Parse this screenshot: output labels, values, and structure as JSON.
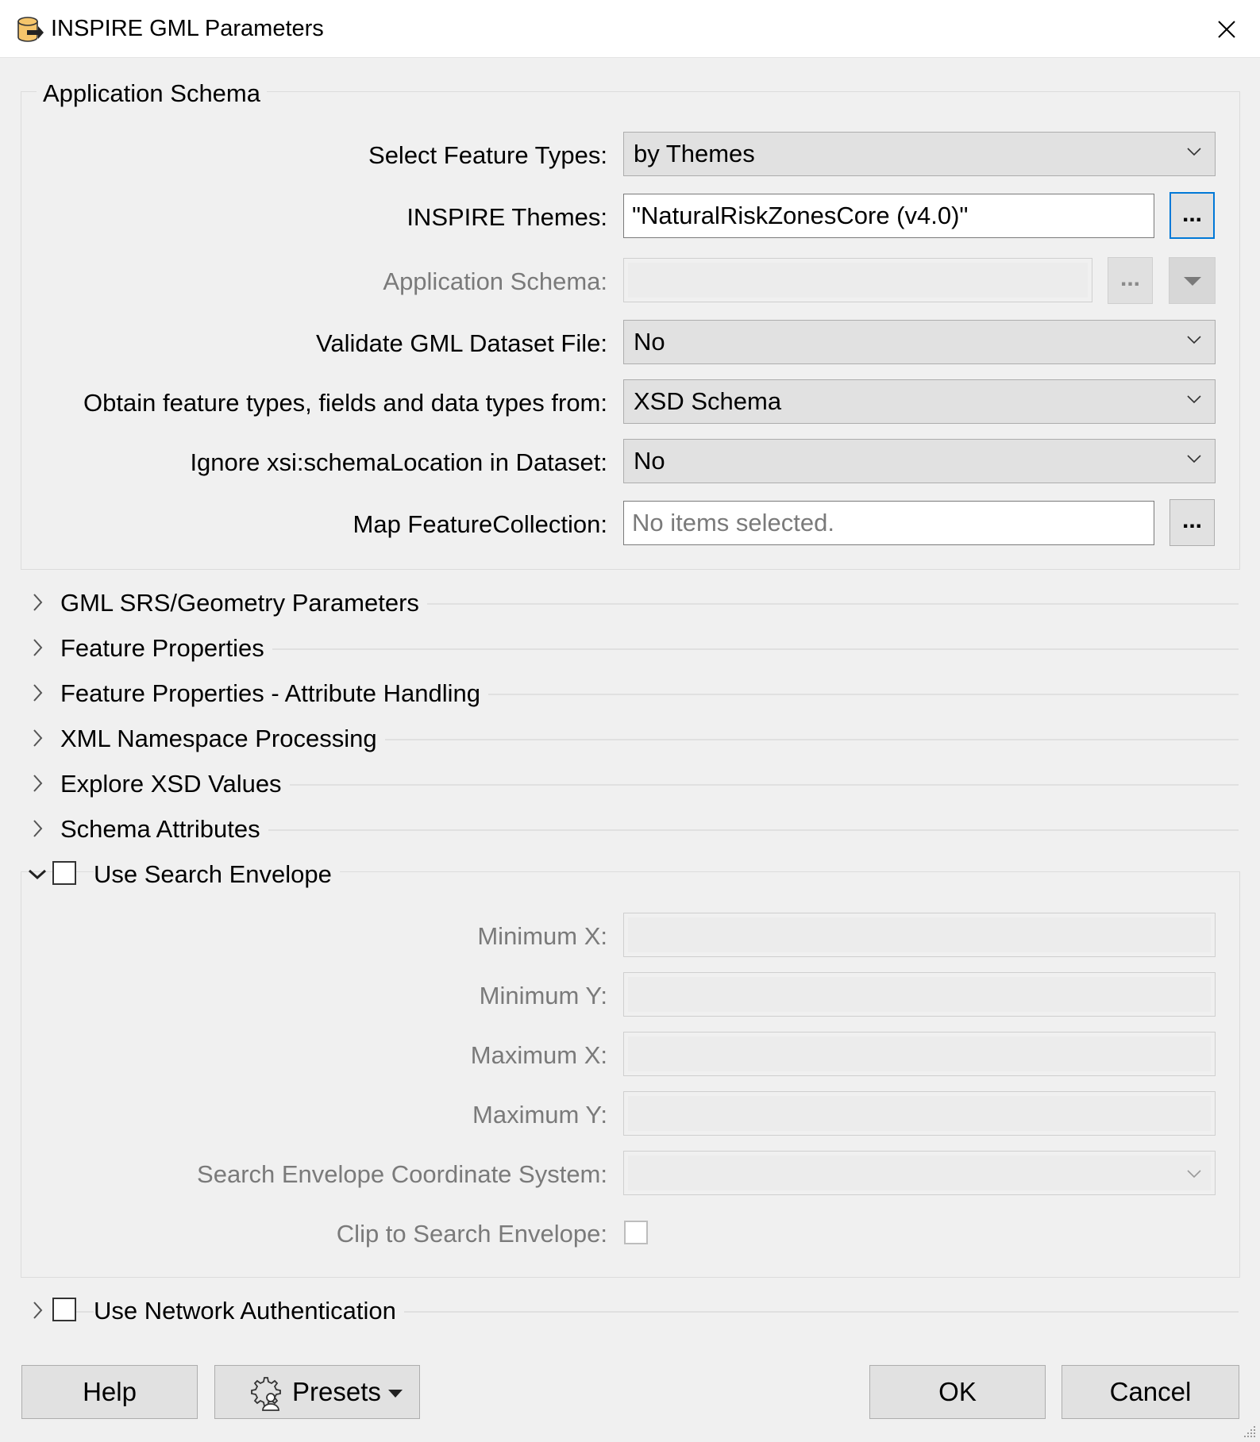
{
  "window": {
    "title": "INSPIRE GML Parameters"
  },
  "application_schema": {
    "group_title": "Application Schema",
    "select_feature_types": {
      "label": "Select Feature Types:",
      "value": "by Themes"
    },
    "inspire_themes": {
      "label": "INSPIRE Themes:",
      "value": "\"NaturalRiskZonesCore (v4.0)\"",
      "button": "..."
    },
    "application_schema": {
      "label": "Application Schema:",
      "value": "",
      "button": "..."
    },
    "validate_gml": {
      "label": "Validate GML Dataset File:",
      "value": "No"
    },
    "obtain_from": {
      "label": "Obtain feature types, fields and data types from:",
      "value": "XSD Schema"
    },
    "ignore_xsi": {
      "label": "Ignore xsi:schemaLocation in Dataset:",
      "value": "No"
    },
    "map_feature_collection": {
      "label": "Map FeatureCollection:",
      "placeholder": "No items selected.",
      "button": "..."
    }
  },
  "sections": [
    {
      "label": "GML SRS/Geometry Parameters"
    },
    {
      "label": "Feature Properties"
    },
    {
      "label": "Feature Properties - Attribute Handling"
    },
    {
      "label": "XML Namespace Processing"
    },
    {
      "label": "Explore XSD Values"
    },
    {
      "label": "Schema Attributes"
    }
  ],
  "search_envelope": {
    "label": "Use Search Envelope",
    "checked": false,
    "min_x": {
      "label": "Minimum X:",
      "value": ""
    },
    "min_y": {
      "label": "Minimum Y:",
      "value": ""
    },
    "max_x": {
      "label": "Maximum X:",
      "value": ""
    },
    "max_y": {
      "label": "Maximum Y:",
      "value": ""
    },
    "coord_system": {
      "label": "Search Envelope Coordinate System:",
      "value": ""
    },
    "clip": {
      "label": "Clip to Search Envelope:",
      "checked": false
    }
  },
  "network_auth": {
    "label": "Use Network Authentication",
    "checked": false
  },
  "buttons": {
    "help": "Help",
    "presets": "Presets",
    "ok": "OK",
    "cancel": "Cancel"
  },
  "icons": {
    "title": "database-reader-icon",
    "close": "close-icon",
    "dropdown": "chevron-down-icon",
    "expand": "chevron-right-icon",
    "collapse": "chevron-down-icon",
    "presets": "gear-user-icon"
  },
  "colors": {
    "focus": "#0078d7",
    "background": "#f0f0f0",
    "button": "#e1e1e1"
  }
}
